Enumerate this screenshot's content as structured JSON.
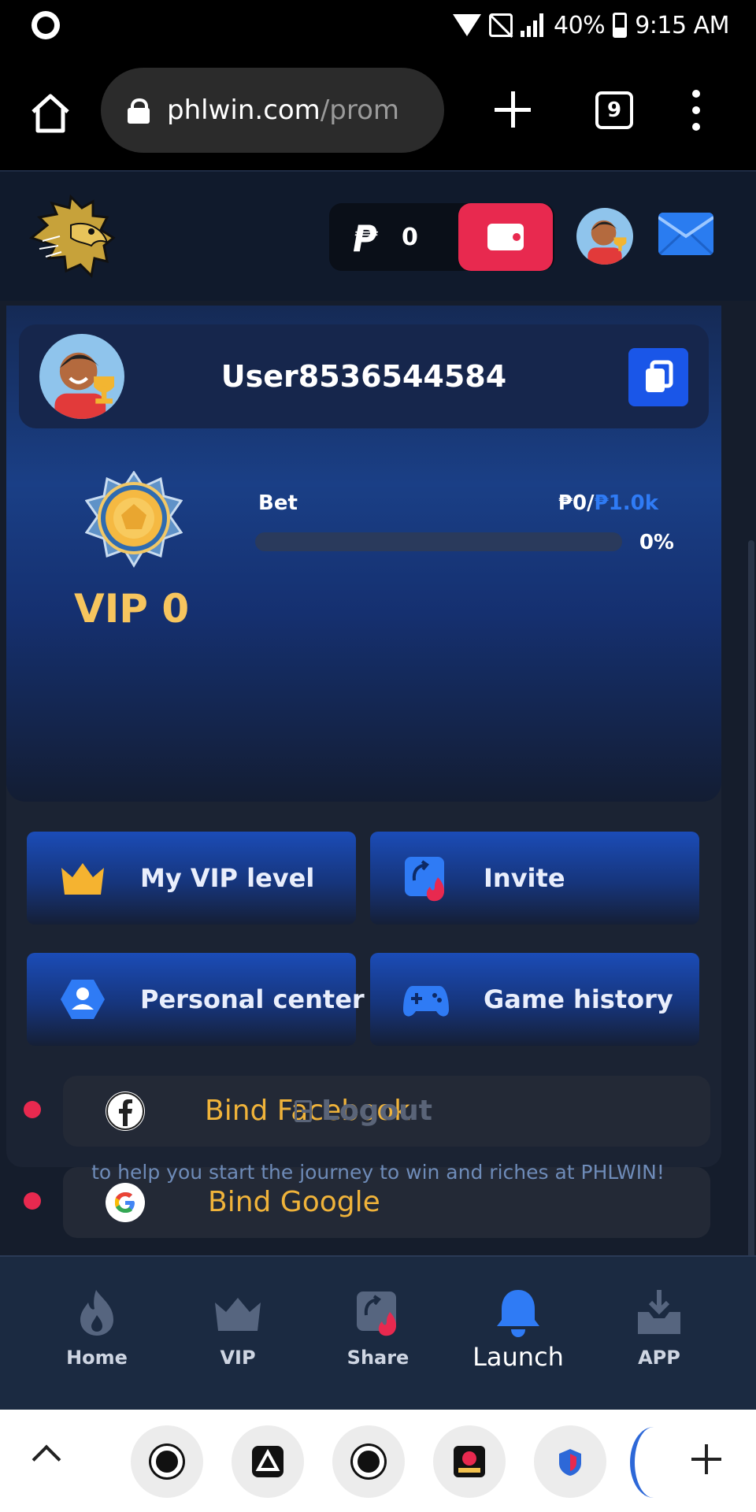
{
  "status_bar": {
    "battery": "40%",
    "time": "9:15 AM"
  },
  "browser": {
    "url_host": "phlwin.com",
    "url_path": "/prom",
    "tab_count": "9"
  },
  "header": {
    "currency_symbol": "₱",
    "balance": "0"
  },
  "profile": {
    "username": "User8536544584"
  },
  "vip": {
    "level_label": "VIP 0",
    "bet_label": "Bet",
    "bet_current": "₱0/",
    "bet_target": "₱1.0k",
    "progress_label": "0%",
    "progress_fraction": 0
  },
  "tiles": [
    {
      "label": "My VIP level",
      "icon": "crown-icon"
    },
    {
      "label": "Invite",
      "icon": "invite-icon"
    },
    {
      "label": "Personal center",
      "icon": "user-hexagon-icon"
    },
    {
      "label": "Game history",
      "icon": "gamepad-icon"
    }
  ],
  "bind": {
    "facebook_label": "Bind Facebook",
    "google_label": "Bind Google"
  },
  "logout_label": "Logout",
  "footer_text": "to help you start the journey to win and riches at PHLWIN!",
  "bottom_nav": [
    {
      "label": "Home",
      "icon": "flame-icon"
    },
    {
      "label": "VIP",
      "icon": "crown-icon"
    },
    {
      "label": "Share",
      "icon": "share-icon"
    },
    {
      "label": "Launch",
      "icon": "bell-icon"
    },
    {
      "label": "APP",
      "icon": "download-icon"
    }
  ],
  "colors": {
    "accent_blue": "#1a56e8",
    "wallet_red": "#e8294f",
    "gold": "#f7c55e",
    "bind_text": "#f0b33a",
    "page_bg": "#151d2c"
  }
}
